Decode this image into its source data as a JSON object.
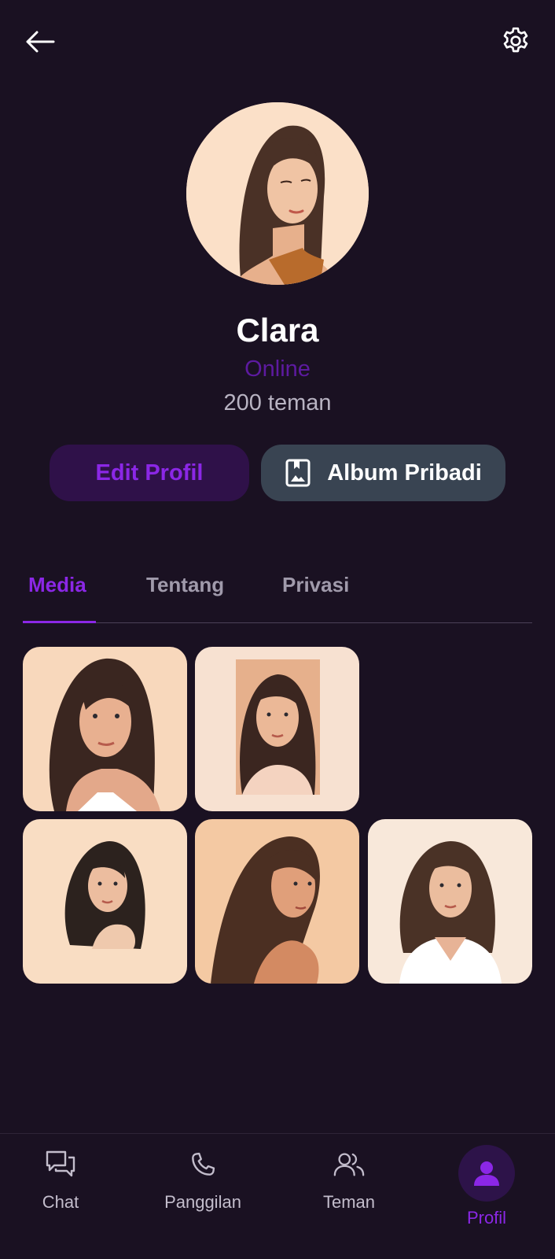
{
  "header": {
    "back_icon": "arrow-left-icon",
    "settings_icon": "gear-icon"
  },
  "profile": {
    "name": "Clara",
    "status": "Online",
    "friends": "200 teman",
    "status_color": "#5d1aa0"
  },
  "actions": {
    "edit_label": "Edit Profil",
    "album_label": "Album Pribadi",
    "album_icon": "album-bookmark-icon"
  },
  "tabs": [
    {
      "label": "Media",
      "active": true
    },
    {
      "label": "Tentang",
      "active": false
    },
    {
      "label": "Privasi",
      "active": false
    }
  ],
  "media": [
    {
      "icon": "portrait-image"
    },
    {
      "icon": "portrait-image"
    },
    {
      "icon": "portrait-image"
    },
    {
      "icon": "portrait-image"
    },
    {
      "icon": "portrait-image"
    }
  ],
  "nav": [
    {
      "label": "Chat",
      "icon": "chat-icon",
      "active": false
    },
    {
      "label": "Panggilan",
      "icon": "phone-icon",
      "active": false
    },
    {
      "label": "Teman",
      "icon": "friends-icon",
      "active": false
    },
    {
      "label": "Profil",
      "icon": "user-icon",
      "active": true
    }
  ],
  "colors": {
    "accent": "#8b27e6",
    "background": "#1a1122"
  }
}
